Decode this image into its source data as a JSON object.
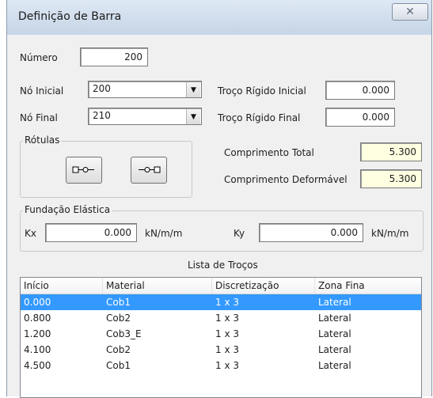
{
  "window": {
    "title": "Definição de Barra",
    "close_glyph": "✕"
  },
  "numero": {
    "label": "Número",
    "value": "200"
  },
  "no_inicial": {
    "label": "Nó Inicial",
    "value": "200"
  },
  "no_final": {
    "label": "Nó Final",
    "value": "210"
  },
  "troco_rigido_inicial": {
    "label": "Troço Rígido Inicial",
    "value": "0.000"
  },
  "troco_rigido_final": {
    "label": "Troço Rígido Final",
    "value": "0.000"
  },
  "rotulas": {
    "title": "Rótulas"
  },
  "comprimento_total": {
    "label": "Comprimento Total",
    "value": "5.300"
  },
  "comprimento_deformavel": {
    "label": "Comprimento Deformável",
    "value": "5.300"
  },
  "fundacao": {
    "title": "Fundação Elástica",
    "kx_label": "Kx",
    "kx_value": "0.000",
    "kx_unit": "kN/m/m",
    "ky_label": "Ky",
    "ky_value": "0.000",
    "ky_unit": "kN/m/m"
  },
  "lista": {
    "title": "Lista de Troços",
    "columns": [
      "Início",
      "Material",
      "Discretização",
      "Zona Fina"
    ],
    "rows": [
      [
        "0.000",
        "Cob1",
        "1 x 3",
        "Lateral"
      ],
      [
        "0.800",
        "Cob2",
        "1 x 3",
        "Lateral"
      ],
      [
        "1.200",
        "Cob3_E",
        "1 x 3",
        "Lateral"
      ],
      [
        "4.100",
        "Cob2",
        "1 x 3",
        "Lateral"
      ],
      [
        "4.500",
        "Cob1",
        "1 x 3",
        "Lateral"
      ]
    ],
    "selected_row": 0
  },
  "colors": {
    "selection": "#3399ff",
    "readonly_field": "#ffffe1"
  }
}
